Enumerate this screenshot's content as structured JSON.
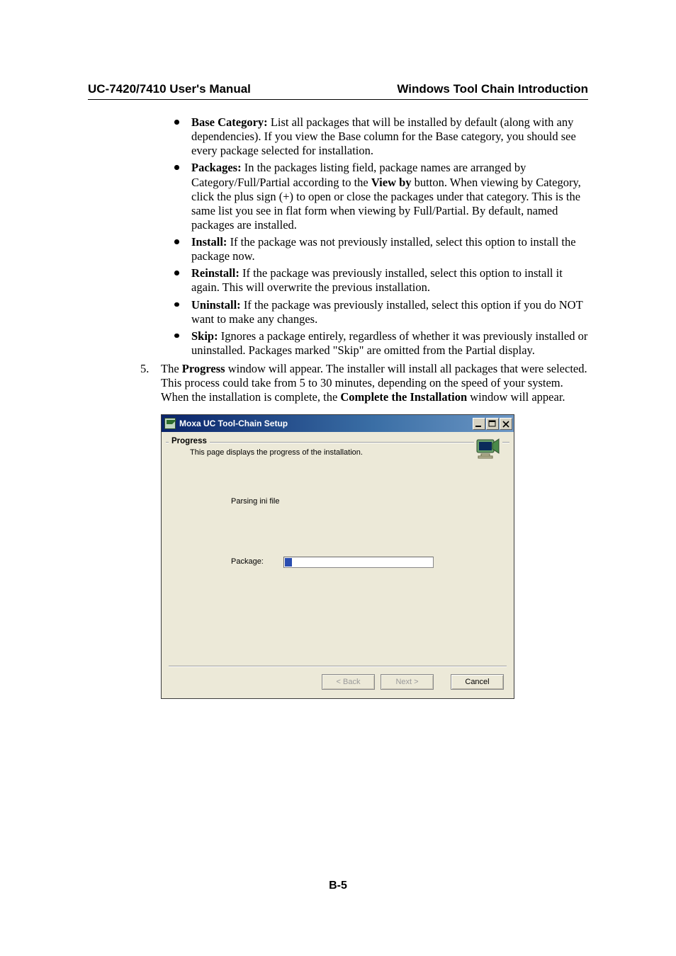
{
  "header": {
    "left": "UC-7420/7410 User's Manual",
    "right": "Windows Tool Chain Introduction"
  },
  "bullets": [
    {
      "label": "Base Category:",
      "text": " List all packages that will be installed by default (along with any dependencies). If you view the Base column for the Base category, you should see every package selected for installation."
    },
    {
      "label": "Packages:",
      "text": " In the packages listing field, package names are arranged by Category/Full/Partial according to the ",
      "label2": "View by",
      "text2": " button. When viewing by Category, click the plus sign (+) to open or close the packages under that category. This is the same list you see in flat form when viewing by Full/Partial. By default, named packages are installed."
    },
    {
      "label": "Install:",
      "text": " If the package was not previously installed, select this option to install the package now."
    },
    {
      "label": "Reinstall:",
      "text": " If the package was previously installed, select this option to install it again. This will overwrite the previous installation."
    },
    {
      "label": "Uninstall:",
      "text": " If the package was previously installed, select this option if you do NOT want to make any changes."
    },
    {
      "label": "Skip:",
      "text": " Ignores a package entirely, regardless of whether it was previously installed or uninstalled. Packages marked \"Skip\" are omitted from the Partial display."
    }
  ],
  "step5": {
    "num": "5.",
    "pre": "The ",
    "bold1": "Progress",
    "mid": " window will appear. The installer will install all packages that were selected. This process could take from 5 to 30 minutes, depending on the speed of your system. When the installation is complete, the ",
    "bold2": "Complete the Installation",
    "post": " window will appear."
  },
  "window": {
    "title": "Moxa UC Tool-Chain Setup",
    "heading": "Progress",
    "subheading": "This page displays the progress of the installation.",
    "status_text": "Parsing ini file",
    "package_label": "Package:",
    "progress_percent": 5,
    "buttons": {
      "back": "< Back",
      "next": "Next >",
      "cancel": "Cancel"
    }
  },
  "page_number": "B-5"
}
